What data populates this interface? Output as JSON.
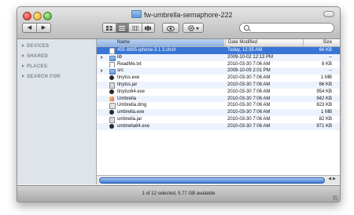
{
  "window": {
    "title": "fw-umbrella-semaphore-222",
    "status": "1 of 12 selected, 5.77 GB available"
  },
  "toolbar": {
    "back_glyph": "◀",
    "forward_glyph": "▶"
  },
  "sidebar": {
    "sections": [
      "DEVICES",
      "SHARED",
      "PLACES",
      "SEARCH FOR"
    ]
  },
  "columns": {
    "name": "Name",
    "date": "Date Modified",
    "size": "Size"
  },
  "files": [
    {
      "name": "455       8895-iphone-3.1.3.shsh",
      "date": "Today, 12:35 AM",
      "size": "66 KB",
      "kind": "shsh",
      "selected": true,
      "folder": false
    },
    {
      "name": "lib",
      "date": "2009-10-02 12:13 PM",
      "size": "--",
      "kind": "folder",
      "selected": false,
      "folder": true
    },
    {
      "name": "ReadMe.txt",
      "date": "2010-03-30 7:06 AM",
      "size": "8 KB",
      "kind": "doc",
      "selected": false,
      "folder": false
    },
    {
      "name": "src",
      "date": "2009-10-09 2:01 PM",
      "size": "--",
      "kind": "folder",
      "selected": false,
      "folder": true
    },
    {
      "name": "tinytss.exe",
      "date": "2010-03-30 7:06 AM",
      "size": "1 MB",
      "kind": "exe",
      "selected": false,
      "folder": false
    },
    {
      "name": "tinytss.jar",
      "date": "2010-03-30 7:06 AM",
      "size": "66 KB",
      "kind": "jar",
      "selected": false,
      "folder": false
    },
    {
      "name": "tinytss64.exe",
      "date": "2010-03-30 7:06 AM",
      "size": "954 KB",
      "kind": "exe",
      "selected": false,
      "folder": false
    },
    {
      "name": "Umbrella",
      "date": "2010-03-30 7:06 AM",
      "size": "942 KB",
      "kind": "app",
      "selected": false,
      "folder": false
    },
    {
      "name": "Umbrella.dmg",
      "date": "2010-03-30 7:06 AM",
      "size": "823 KB",
      "kind": "dmg",
      "selected": false,
      "folder": false
    },
    {
      "name": "umbrella.exe",
      "date": "2010-03-30 7:06 AM",
      "size": "1 MB",
      "kind": "exe",
      "selected": false,
      "folder": false
    },
    {
      "name": "umbrella.jar",
      "date": "2010-03-30 7:06 AM",
      "size": "82 KB",
      "kind": "jar",
      "selected": false,
      "folder": false
    },
    {
      "name": "umbrella64.exe",
      "date": "2010-03-30 7:06 AM",
      "size": "971 KB",
      "kind": "exe",
      "selected": false,
      "folder": false
    }
  ],
  "colors": {
    "selection": "#3875d7",
    "alt_row": "#edf3fe",
    "sidebar": "#dfe4ea"
  }
}
